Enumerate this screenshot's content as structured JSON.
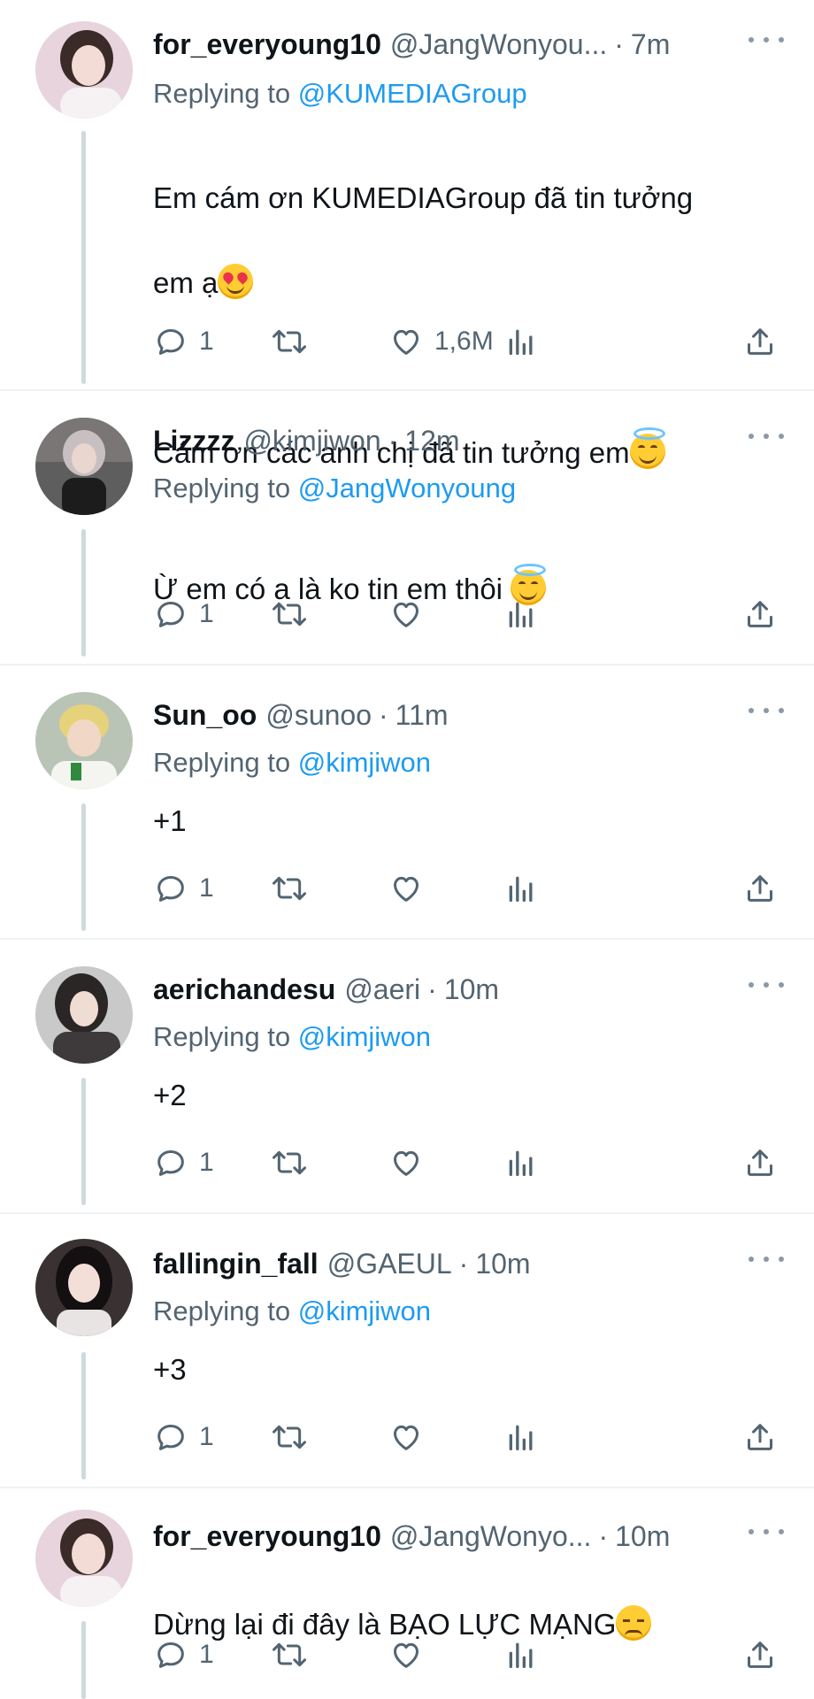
{
  "tweets": [
    {
      "name": "for_everyoung10",
      "handle": "@JangWonyou...",
      "time": "7m",
      "replying_prefix": "Replying to ",
      "replying_to": "@KUMEDIAGroup",
      "line1": "Em cám ơn KUMEDIAGroup đã tin tưởng",
      "line2": "em ạ",
      "line3": "",
      "line4": "Cám ơn các anh chị đã tin tưởng em",
      "emoji1": "smiling-face-with-heart-eyes-emoji",
      "emoji2": "smiling-face-with-halo-emoji",
      "reply_count": "1",
      "like_count": "1,6M",
      "avatar": {
        "bg": "#e7d4dc",
        "hair": "#3a2a28",
        "skin": "#f3dcd5"
      }
    },
    {
      "name": "Lizzzz",
      "handle": "@kimjiwon",
      "time": "12m",
      "replying_prefix": "Replying to ",
      "replying_to": "@JangWonyoung",
      "text": "Ừ em có a là ko tin em thôi ",
      "emoji": "smiling-face-with-halo-emoji",
      "reply_count": "1",
      "avatar": {
        "bg": "#6a6a6a",
        "hair": "#c8c0c0",
        "skin": "#e9d6cf"
      }
    },
    {
      "name": "Sun_oo",
      "handle": "@sunoo",
      "time": "11m",
      "replying_prefix": "Replying to ",
      "replying_to": "@kimjiwon",
      "text": "+1",
      "reply_count": "1",
      "avatar": {
        "bg": "#b9c4b6",
        "hair": "#e7d27c",
        "skin": "#f1d8c6"
      }
    },
    {
      "name": "aerichandesu",
      "handle": "@aeri",
      "time": "10m",
      "replying_prefix": "Replying to ",
      "replying_to": "@kimjiwon",
      "text": "+2",
      "reply_count": "1",
      "avatar": {
        "bg": "#c9c9c9",
        "hair": "#2b2626",
        "skin": "#efdcd3"
      }
    },
    {
      "name": "fallingin_fall",
      "handle": "@GAEUL",
      "time": "10m",
      "replying_prefix": "Replying to ",
      "replying_to": "@kimjiwon",
      "text": "+3",
      "reply_count": "1",
      "avatar": {
        "bg": "#3a3232",
        "hair": "#141012",
        "skin": "#f4dfd8"
      }
    },
    {
      "name": "for_everyoung10",
      "handle": "@JangWonyo...",
      "time": "10m",
      "text": "Dừng lại đi đây là BẠO LỰC MẠNG",
      "emoji": "pensive-face-emoji",
      "reply_count": "1",
      "avatar": {
        "bg": "#e7d4dc",
        "hair": "#3a2a28",
        "skin": "#f3dcd5"
      }
    }
  ]
}
